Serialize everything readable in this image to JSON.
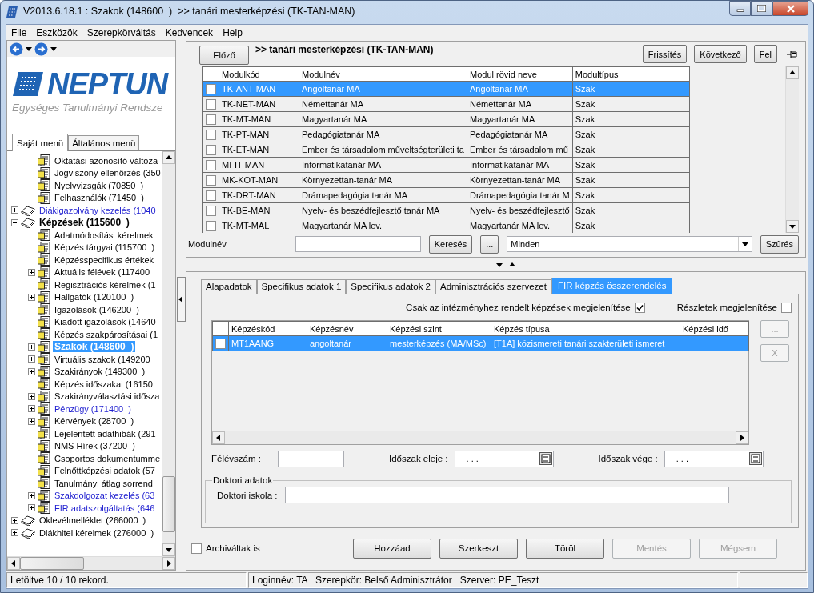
{
  "window": {
    "title": "V2013.6.18.1 : Szakok (148600  )  >> tanári mesterképzési (TK-TAN-MAN)"
  },
  "menu": [
    "File",
    "Eszközök",
    "Szerepkörváltás",
    "Kedvencek",
    "Help"
  ],
  "sidebar": {
    "logo": "NEPTUN",
    "tagline": "Egységes Tanulmányi Rendsze",
    "tabs": [
      {
        "label": "Saját menü",
        "selected": true
      },
      {
        "label": "Általános menü",
        "selected": false
      }
    ],
    "tree": {
      "scrolled_children": [
        {
          "label": "Oktatási azonosító változa",
          "kind": "page",
          "selected": false
        },
        {
          "label": "Jogviszony ellenőrzés (350",
          "kind": "page",
          "selected": false
        },
        {
          "label": "Nyelvvizsgák (70850  )",
          "kind": "page",
          "selected": false
        },
        {
          "label": "Felhasználók (71450  )",
          "kind": "page",
          "selected": false
        }
      ],
      "nodes": [
        {
          "label": "Diákigazolvány kezelés (1040",
          "kind": "group",
          "expanded": false,
          "selected": false,
          "color": "#1f1fd0"
        },
        {
          "label": "Képzések (115600  )",
          "kind": "group",
          "expanded": true,
          "selected": false,
          "children": [
            {
              "label": "Adatmódosítási kérelmek",
              "kind": "page",
              "selected": false
            },
            {
              "label": "Képzés tárgyai (115700  )",
              "kind": "page",
              "selected": false
            },
            {
              "label": "Képzésspecifikus értékek",
              "kind": "page",
              "selected": false
            },
            {
              "label": "Aktuális félévek (117400",
              "kind": "page",
              "expanded": false,
              "selected": false
            },
            {
              "label": "Regisztrációs kérelmek (1",
              "kind": "page",
              "selected": false
            },
            {
              "label": "Hallgatók (120100  )",
              "kind": "page",
              "expanded": false,
              "selected": false
            },
            {
              "label": "Igazolások (146200  )",
              "kind": "page",
              "selected": false
            },
            {
              "label": "Kiadott igazolások (14640",
              "kind": "page",
              "selected": false
            },
            {
              "label": "Képzés szakpárosításai (1",
              "kind": "page",
              "selected": false
            },
            {
              "label": "Szakok (148600  )",
              "kind": "page",
              "expanded": false,
              "selected": true
            },
            {
              "label": "Virtuális szakok (149200",
              "kind": "page",
              "expanded": false,
              "selected": false
            },
            {
              "label": "Szakirányok (149300  )",
              "kind": "page",
              "expanded": false,
              "selected": false
            },
            {
              "label": "Képzés időszakai (16150",
              "kind": "page",
              "selected": false
            },
            {
              "label": "Szakirányválasztási idősza",
              "kind": "page",
              "expanded": false,
              "selected": false
            },
            {
              "label": "Pénzügy (171400  )",
              "kind": "page",
              "expanded": false,
              "selected": false,
              "color": "#1f1fd0"
            },
            {
              "label": "Kérvények (28700  )",
              "kind": "page",
              "expanded": false,
              "selected": false
            },
            {
              "label": "Lejelentett adathibák (291",
              "kind": "page",
              "selected": false
            },
            {
              "label": "NMS Hírek (37200  )",
              "kind": "page",
              "selected": false
            },
            {
              "label": "Csoportos dokumentumme",
              "kind": "page",
              "selected": false
            },
            {
              "label": "Felnőttképzési adatok (57",
              "kind": "page",
              "selected": false
            },
            {
              "label": "Tanulmányi átlag sorrend",
              "kind": "page",
              "selected": false
            },
            {
              "label": "Szakdolgozat kezelés (63",
              "kind": "page",
              "expanded": false,
              "selected": false,
              "color": "#1f1fd0"
            },
            {
              "label": "FIR adatszolgáltatás (646",
              "kind": "page",
              "expanded": false,
              "selected": false,
              "color": "#1f1fd0"
            }
          ]
        },
        {
          "label": "Oklevélmelléklet (266000  )",
          "kind": "group",
          "expanded": false,
          "selected": false
        },
        {
          "label": "Diákhitel kérelmek (276000  )",
          "kind": "group",
          "expanded": false,
          "selected": false
        }
      ]
    }
  },
  "header": {
    "prev_button": "Előző",
    "title": ">> tanári mesterképzési (TK-TAN-MAN)",
    "buttons": [
      "Frissítés",
      "Következő",
      "Fel"
    ]
  },
  "module_table": {
    "columns": [
      "Modulkód",
      "Modulnév",
      "Modul rövid neve",
      "Modultípus"
    ],
    "rows": [
      {
        "cells": [
          "TK-ANT-MAN",
          "Angoltanár MA",
          "Angoltanár MA",
          "Szak"
        ],
        "checked": false,
        "selected": true
      },
      {
        "cells": [
          "TK-NET-MAN",
          "Némettanár MA",
          "Némettanár MA",
          "Szak"
        ],
        "checked": false,
        "selected": false
      },
      {
        "cells": [
          "TK-MT-MAN",
          "Magyartanár MA",
          "Magyartanár MA",
          "Szak"
        ],
        "checked": false,
        "selected": false
      },
      {
        "cells": [
          "TK-PT-MAN",
          "Pedagógiatanár MA",
          "Pedagógiatanár MA",
          "Szak"
        ],
        "checked": false,
        "selected": false
      },
      {
        "cells": [
          "TK-ET-MAN",
          "Ember és társadalom műveltségterületi ta",
          "Ember és társadalom mű",
          "Szak"
        ],
        "checked": false,
        "selected": false
      },
      {
        "cells": [
          "MI-IT-MAN",
          "Informatikatanár MA",
          "Informatikatanár MA",
          "Szak"
        ],
        "checked": false,
        "selected": false
      },
      {
        "cells": [
          "MK-KOT-MAN",
          "Környezettan-tanár MA",
          "Környezettan-tanár MA",
          "Szak"
        ],
        "checked": false,
        "selected": false
      },
      {
        "cells": [
          "TK-DRT-MAN",
          "Drámapedagógia tanár MA",
          "Drámapedagógia tanár M",
          "Szak"
        ],
        "checked": false,
        "selected": false
      },
      {
        "cells": [
          "TK-BE-MAN",
          "Nyelv- és beszédfejlesztő tanár MA",
          "Nyelv- és beszédfejlesztő",
          "Szak"
        ],
        "checked": false,
        "selected": false
      },
      {
        "cells": [
          "TK-MT-MAL",
          "Magyartanár MA lev.",
          "Magyartanár MA lev.",
          "Szak"
        ],
        "checked": false,
        "selected": false
      }
    ]
  },
  "filter": {
    "label": "Modulnév",
    "search_button": "Keresés",
    "more_button": "...",
    "dropdown": "Minden",
    "filter_button": "Szűrés"
  },
  "detail": {
    "tabs": [
      {
        "label": "Alapadatok",
        "selected": false
      },
      {
        "label": "Specifikus adatok 1",
        "selected": false
      },
      {
        "label": "Specifikus adatok 2",
        "selected": false
      },
      {
        "label": "Adminisztrációs szervezet",
        "selected": false
      },
      {
        "label": "FIR képzés összerendelés",
        "selected": true
      }
    ],
    "options": [
      {
        "label": "Csak az intézményhez rendelt képzések megjelenítése",
        "checked": true
      },
      {
        "label": "Részletek megjelenítése",
        "checked": false
      }
    ],
    "table": {
      "columns": [
        "Képzéskód",
        "Képzésnév",
        "Képzési szint",
        "Képzés típusa",
        "Képzési idő"
      ],
      "rows": [
        {
          "cells": [
            "MT1AANG",
            "angoltanár",
            "mesterképzés (MA/MSc)",
            "[T1A] közismereti tanári szakterületi ismeret",
            ""
          ],
          "checked": false,
          "selected": true
        }
      ]
    },
    "side_buttons": [
      {
        "label": "...",
        "disabled": true
      },
      {
        "label": "X",
        "disabled": true
      }
    ],
    "fields": [
      {
        "label": "Félévszám :",
        "kind": "text"
      },
      {
        "label": "Időszak eleje :",
        "kind": "date",
        "value": ". . ."
      },
      {
        "label": "Időszak vége :",
        "kind": "date",
        "value": ". . ."
      }
    ],
    "group": {
      "title": "Doktori adatok",
      "fields": [
        {
          "label": "Doktori iskola :"
        }
      ]
    }
  },
  "footer": {
    "archived": {
      "label": "Archiváltak is",
      "checked": false
    },
    "buttons": [
      {
        "label": "Hozzáad",
        "disabled": false
      },
      {
        "label": "Szerkeszt",
        "disabled": false
      },
      {
        "label": "Töröl",
        "disabled": false
      },
      {
        "label": "Mentés",
        "disabled": true
      },
      {
        "label": "Mégsem",
        "disabled": true
      }
    ]
  },
  "status_bar": [
    "Letöltve 10 / 10 rekord.",
    "Loginnév: TA   Szerepkör: Belső Adminisztrátor   Szerver: PE_Teszt"
  ]
}
